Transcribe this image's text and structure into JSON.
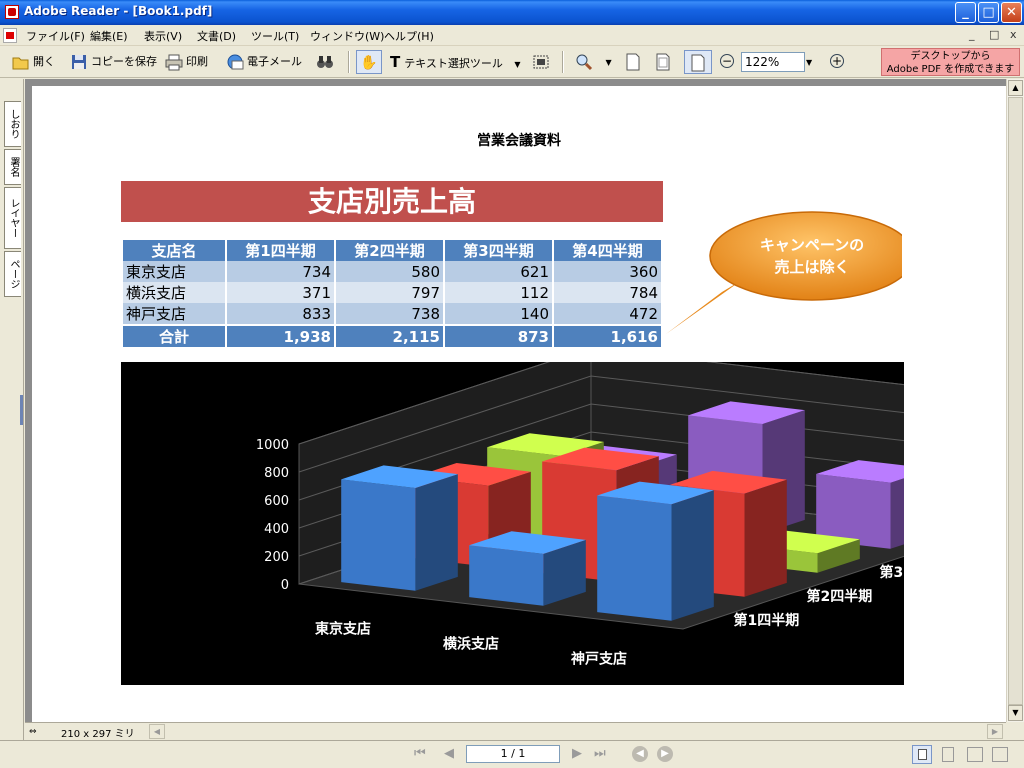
{
  "window": {
    "title": "Adobe Reader - [Book1.pdf]",
    "min": "_",
    "max": "□",
    "close": "✕"
  },
  "menu": {
    "items": [
      "ファイル(F)",
      "編集(E)",
      "表示(V)",
      "文書(D)",
      "ツール(T)",
      "ウィンドウ(W)",
      "ヘルプ(H)"
    ],
    "mdi_min": "_",
    "mdi_restore": "□",
    "mdi_close": "x"
  },
  "toolbar": {
    "open": "開く",
    "save_copy": "コピーを保存",
    "print": "印刷",
    "email": "電子メール",
    "select_text": "テキスト選択ツール",
    "zoom": "122%",
    "promo_line1": "デスクトップから",
    "promo_line2": "Adobe PDF を作成できます"
  },
  "navtabs": [
    "しおり",
    "署名",
    "レイヤー",
    "ページ"
  ],
  "status": {
    "page_size": "210 x 297 ミリ",
    "page_indicator": "1 / 1"
  },
  "document": {
    "heading": "営業会議資料",
    "banner": "支店別売上高",
    "table": {
      "headers": [
        "支店名",
        "第1四半期",
        "第2四半期",
        "第3四半期",
        "第4四半期"
      ],
      "rows": [
        [
          "東京支店",
          "734",
          "580",
          "621",
          "360"
        ],
        [
          "横浜支店",
          "371",
          "797",
          "112",
          "784"
        ],
        [
          "神戸支店",
          "833",
          "738",
          "140",
          "472"
        ]
      ],
      "total": [
        "合計",
        "1,938",
        "2,115",
        "873",
        "1,616"
      ]
    },
    "callout": {
      "line1": "キャンペーンの",
      "line2": "売上は除く",
      "fill": "#f39a1f"
    }
  },
  "chart_data": {
    "type": "bar",
    "categories": [
      "東京支店",
      "横浜支店",
      "神戸支店"
    ],
    "series": [
      {
        "name": "第1四半期",
        "values": [
          734,
          371,
          833
        ],
        "color": "#3a78c9"
      },
      {
        "name": "第2四半期",
        "values": [
          580,
          797,
          738
        ],
        "color": "#d93a33"
      },
      {
        "name": "第3四半期",
        "values": [
          621,
          112,
          140
        ],
        "color": "#9ac53a"
      },
      {
        "name": "第4四半期",
        "values": [
          360,
          784,
          472
        ],
        "color": "#8a5cc0"
      }
    ],
    "ylim": [
      0,
      1000
    ],
    "yticks": [
      "0",
      "200",
      "400",
      "600",
      "800",
      "1000"
    ],
    "background": "#000000"
  }
}
